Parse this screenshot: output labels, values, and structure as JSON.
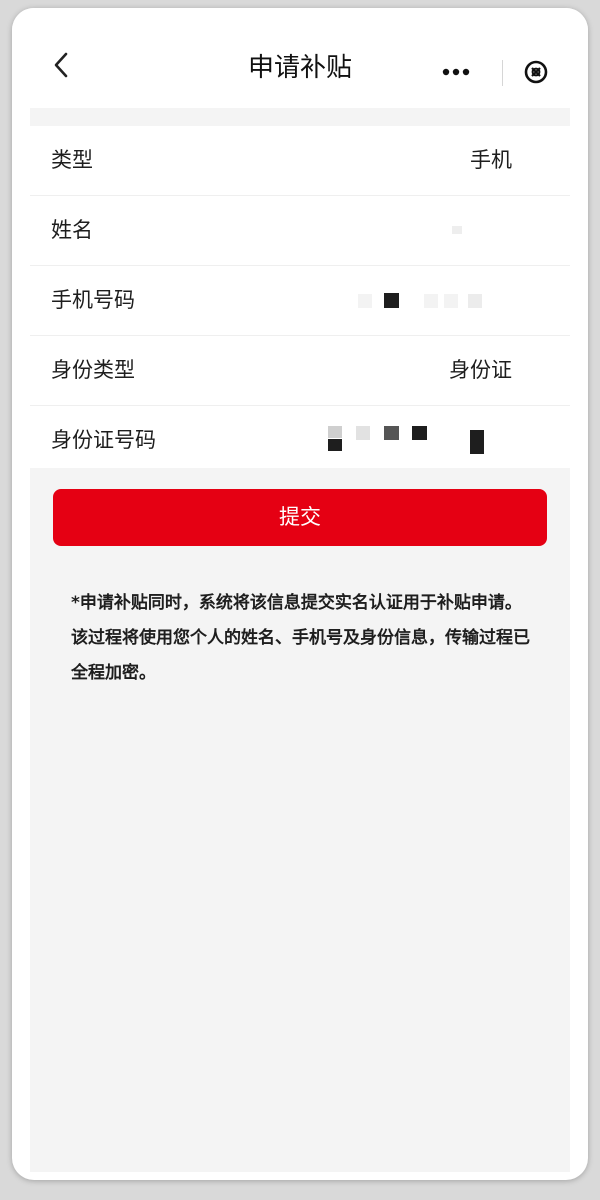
{
  "header": {
    "title": "申请补贴",
    "back_icon": "chevron-left-icon",
    "more_icon": "more-dots-icon",
    "close_icon": "close-circle-icon"
  },
  "form": {
    "rows": [
      {
        "label": "类型",
        "value": "手机"
      },
      {
        "label": "姓名",
        "value": ""
      },
      {
        "label": "手机号码",
        "value": ""
      },
      {
        "label": "身份类型",
        "value": "身份证"
      },
      {
        "label": "身份证号码",
        "value": ""
      }
    ]
  },
  "submit": {
    "label": "提交"
  },
  "notice": {
    "text": "*申请补贴同时，系统将该信息提交实名认证用于补贴申请。该过程将使用您个人的姓名、手机号及身份信息，传输过程已全程加密。"
  },
  "colors": {
    "accent": "#e50013",
    "background": "#f4f4f4",
    "text": "#1e1e1e"
  }
}
